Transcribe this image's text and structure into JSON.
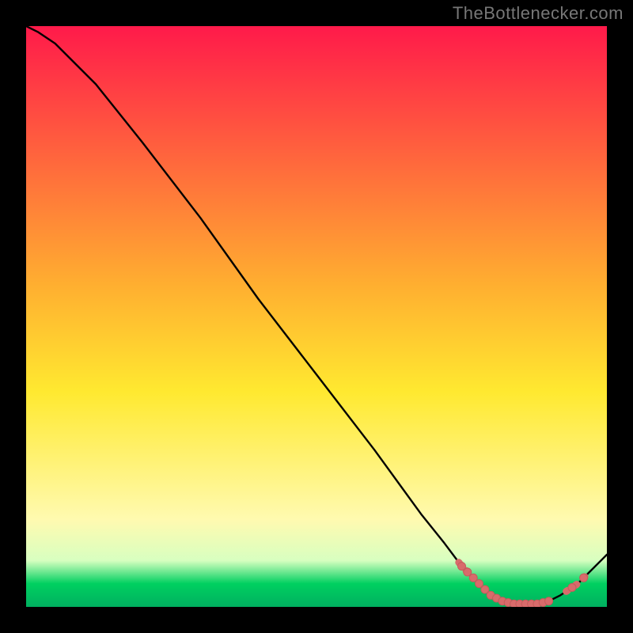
{
  "watermark": "TheBottlenecker.com",
  "colors": {
    "top": "#ff1a4a",
    "upper_mid": "#ffb030",
    "mid": "#ffe930",
    "low": "#fffab0",
    "band_light": "#d8ffc0",
    "band_green": "#00d060",
    "bottom": "#00b060",
    "curve": "#000000",
    "dot_fill": "#d86b6b",
    "dot_stroke": "#c55b5b"
  },
  "chart_data": {
    "type": "line",
    "title": "",
    "xlabel": "",
    "ylabel": "",
    "xlim": [
      0,
      100
    ],
    "ylim": [
      0,
      100
    ],
    "series": [
      {
        "name": "bottleneck-curve",
        "x": [
          0,
          2,
          5,
          8,
          12,
          20,
          30,
          40,
          50,
          60,
          68,
          72,
          75,
          78,
          80,
          82,
          84,
          86,
          88,
          90,
          92,
          95,
          98,
          100
        ],
        "y": [
          100,
          99,
          97,
          94,
          90,
          80,
          67,
          53,
          40,
          27,
          16,
          11,
          7,
          4,
          2,
          1,
          0.5,
          0.5,
          0.5,
          1,
          2,
          4,
          7,
          9
        ]
      }
    ],
    "dots": {
      "name": "highlight-points",
      "x": [
        75,
        76,
        77,
        78,
        79,
        80,
        81,
        82,
        83,
        84,
        85,
        86,
        87,
        88,
        89,
        90,
        94,
        96
      ],
      "y": [
        6.5,
        5.5,
        4.5,
        3.8,
        3.2,
        2.6,
        2.1,
        1.7,
        1.4,
        1.2,
        1.0,
        0.9,
        0.9,
        1.0,
        1.2,
        1.5,
        2.8,
        3.8
      ]
    },
    "dotted_segments": [
      {
        "x_range": [
          74.5,
          76.5
        ]
      },
      {
        "x_range": [
          93.0,
          96.5
        ]
      }
    ]
  }
}
